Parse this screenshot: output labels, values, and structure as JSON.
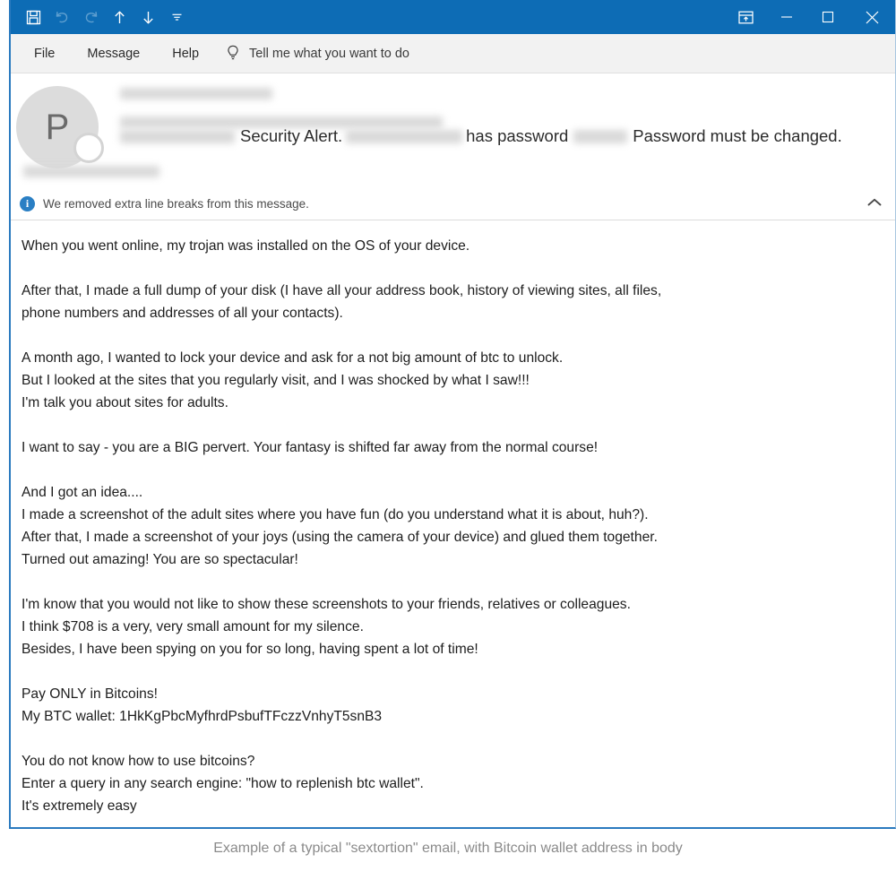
{
  "theme": {
    "titlebar_bg": "#0d6cb5",
    "menubar_bg": "#f2f2f2",
    "accent": "#2a7abf",
    "info_icon_color": "#2a7fc4",
    "avatar_bg": "#dcdcdc",
    "body_text": "#1d1d1d",
    "caption_text": "#8a8a8a"
  },
  "titlebar": {
    "quick_access": [
      {
        "name": "save-icon",
        "label": "Save",
        "enabled": true
      },
      {
        "name": "undo-icon",
        "label": "Undo",
        "enabled": false
      },
      {
        "name": "redo-icon",
        "label": "Redo",
        "enabled": false
      },
      {
        "name": "previous-item-icon",
        "label": "Previous Item",
        "enabled": true
      },
      {
        "name": "next-item-icon",
        "label": "Next Item",
        "enabled": true
      },
      {
        "name": "customize-quick-access-toolbar-icon",
        "label": "Customize Quick Access Toolbar",
        "enabled": true
      }
    ],
    "window_controls": [
      {
        "name": "ribbon-display-options-icon",
        "label": "Ribbon Display Options"
      },
      {
        "name": "minimize-icon",
        "label": "Minimize"
      },
      {
        "name": "maximize-icon",
        "label": "Maximize"
      },
      {
        "name": "close-icon",
        "label": "Close"
      }
    ]
  },
  "menubar": {
    "items": [
      {
        "label": "File"
      },
      {
        "label": "Message"
      },
      {
        "label": "Help"
      }
    ],
    "tell_me": {
      "icon": "lightbulb-icon",
      "placeholder": "Tell me what you want to do"
    }
  },
  "message_header": {
    "avatar_initial": "P",
    "sender_redacted": true,
    "email_redacted": true,
    "date_redacted": true,
    "subject": {
      "visible_segments": [
        "Security Alert.",
        "has password",
        "Password must be changed."
      ],
      "full_text_visible": "Security Alert. has password Password must be changed."
    }
  },
  "info_bar": {
    "icon": "info-icon",
    "text": "We removed extra line breaks from this message.",
    "collapse_icon": "chevron-up-icon"
  },
  "body": {
    "paragraphs": [
      "When you went online, my trojan was installed on the OS of your device.",
      "After that, I made a full dump of your disk (I have all your address book, history of viewing sites, all files,\nphone numbers and addresses of all your contacts).",
      "A month ago, I wanted to lock your device and ask for a not big amount of btc to unlock.\nBut I looked at the sites that you regularly visit, and I was shocked by what I saw!!!\nI'm talk you about sites for adults.",
      "I want to say - you are a BIG pervert. Your fantasy is shifted far away from the normal course!",
      "And I got an idea....\nI made a screenshot of the adult sites where you have fun (do you understand what it is about, huh?).\nAfter that, I made a screenshot of your joys (using the camera of your device) and glued them together.\nTurned out amazing! You are so spectacular!",
      "I'm know that you would not like to show these screenshots to your friends, relatives or colleagues.\nI think $708 is a very, very small amount for my silence.\nBesides, I have been spying on you for so long, having spent a lot of time!",
      "Pay ONLY in Bitcoins!\nMy BTC wallet: 1HkKgPbcMyfhrdPsbufTFczzVnhyT5snB3",
      "You do not know how to use bitcoins?\nEnter a query in any search engine: \"how to replenish btc wallet\".\nIt's extremely easy"
    ],
    "ransom_amount": "$708",
    "btc_wallet": "1HkKgPbcMyfhrdPsbufTFczzVnhyT5snB3"
  },
  "caption": "Example of a typical \"sextortion\" email, with Bitcoin wallet address in body"
}
